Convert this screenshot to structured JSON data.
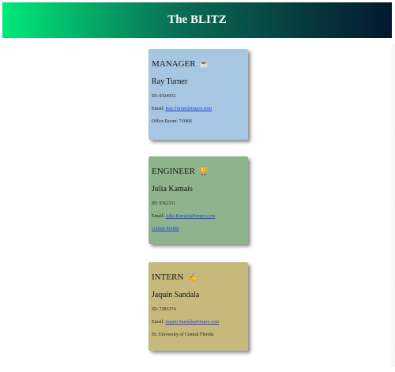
{
  "header": {
    "title": "The BLITZ"
  },
  "cards": {
    "manager": {
      "role": "MANAGER",
      "emoji": "☕",
      "name": "Ray Turner",
      "id_line": "ID: 9324932",
      "email_label": "Email:",
      "email": "Ray.Turner@tmpro.com",
      "extra": "Office Room: 7/0406"
    },
    "engineer": {
      "role": "ENGINEER",
      "emoji": "🏆",
      "name": "Julia Kamais",
      "id_line": "ID: 9362311",
      "email_label": "Email:",
      "email": "Julia.Kamais@tmpro.com",
      "extra": "Github Profile"
    },
    "intern": {
      "role": "INTERN",
      "emoji": "✍",
      "name": "Jaquin Sandala",
      "id_line": "ID: 7283374",
      "email_label": "Email:",
      "email": "Jaquin.Sandala@tmpro.com",
      "extra": "IS: University of Central Florida"
    }
  }
}
